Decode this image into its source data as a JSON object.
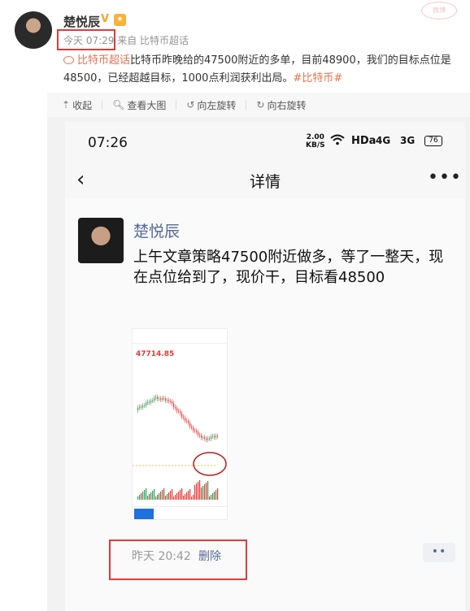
{
  "post": {
    "username": "楚悦辰",
    "time": "今天 07:29",
    "source": "来自 比特币超话",
    "topic": "比特币超话",
    "body": "比特币昨晚给的47500附近的多单，目前48900，我们的目标点位是48500，已经超越目标，1000点利润获利出局。",
    "tag": "#比特币#",
    "watermark_text": "微博"
  },
  "toolbar": {
    "collapse": "收起",
    "view_large": "查看大图",
    "rotate_left": "向左旋转",
    "rotate_right": "向右旋转"
  },
  "phone": {
    "status_time": "07:26",
    "speed_value": "2.00",
    "speed_unit": "KB/S",
    "hd": "HDa",
    "net1": "4G",
    "net2": "3G",
    "battery": "76",
    "nav_title": "详情",
    "author": "楚悦辰",
    "text": "上午文章策略47500附近做多，等了一整天，现在点位给到了，现价干，目标看48500",
    "chart_price": "47714.85",
    "footer_time": "昨天 20:42",
    "footer_delete": "删除"
  },
  "colors": {
    "highlight": "#e53935",
    "link": "#576b95",
    "topic": "#eb7350"
  },
  "icons": [
    "back-chevron-icon",
    "more-dots-icon",
    "wifi-icon",
    "collapse-icon",
    "magnifier-icon",
    "rotate-left-icon",
    "rotate-right-icon"
  ]
}
